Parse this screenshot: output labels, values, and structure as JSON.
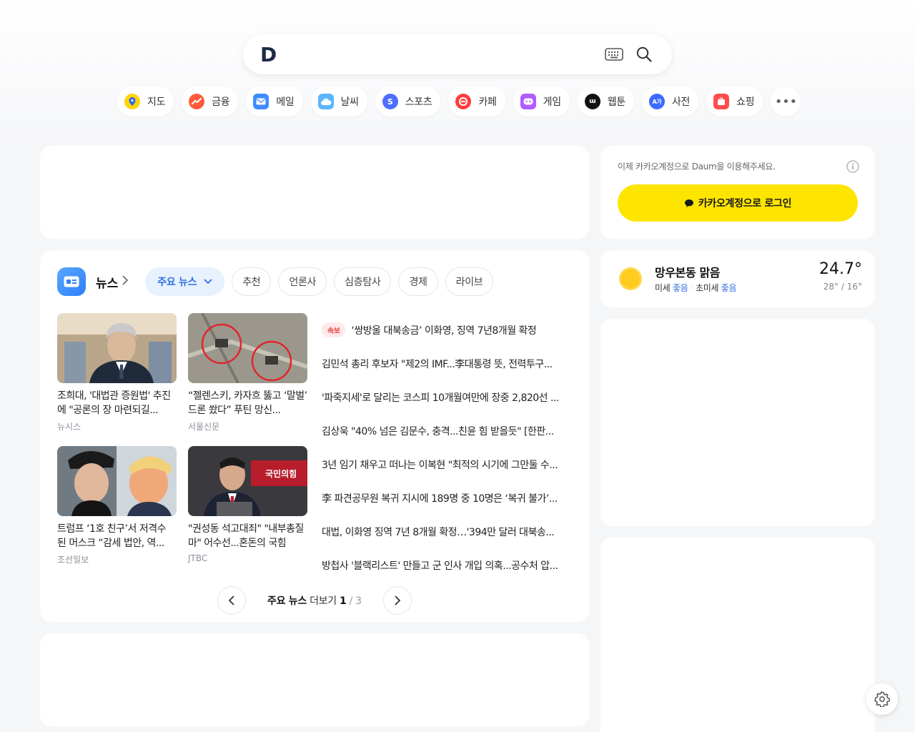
{
  "header": {
    "logo": "D",
    "search_placeholder": ""
  },
  "services": [
    {
      "label": "지도",
      "icon": "map-pin-icon",
      "color": "#ffd400"
    },
    {
      "label": "금융",
      "icon": "chart-up-icon",
      "color": "#ff5b3a"
    },
    {
      "label": "메일",
      "icon": "mail-icon",
      "color": "#3d8bff"
    },
    {
      "label": "날씨",
      "icon": "cloud-icon",
      "color": "#5bb6ff"
    },
    {
      "label": "스포츠",
      "icon": "sports-icon",
      "color": "#4c6fff"
    },
    {
      "label": "카페",
      "icon": "cafe-icon",
      "color": "#ff3b3b"
    },
    {
      "label": "게임",
      "icon": "game-icon",
      "color": "#b05cff"
    },
    {
      "label": "웹툰",
      "icon": "webtoon-icon",
      "color": "#111111"
    },
    {
      "label": "사전",
      "icon": "dictionary-icon",
      "color": "#3d6bff"
    },
    {
      "label": "쇼핑",
      "icon": "shopping-bag-icon",
      "color": "#ff4d4d"
    }
  ],
  "login": {
    "message": "이제 카카오계정으로 Daum을 이용해주세요.",
    "button": "카카오계정으로 로그인"
  },
  "weather": {
    "location_condition": "망우본동 맑음",
    "dust_label": "미세",
    "dust_value": "좋음",
    "fine_dust_label": "초미세",
    "fine_dust_value": "좋음",
    "temp": "24.7°",
    "range": "28° / 16°"
  },
  "news": {
    "title": "뉴스",
    "tabs": [
      {
        "label": "주요 뉴스",
        "active": true
      },
      {
        "label": "추천"
      },
      {
        "label": "언론사"
      },
      {
        "label": "심층탐사"
      },
      {
        "label": "경제"
      },
      {
        "label": "라이브"
      }
    ],
    "thumbs": [
      {
        "title": "조희대, '대법관 증원법' 추진에 \"공론의 장 마련되길...",
        "source": "뉴시스"
      },
      {
        "title": "“젤렌스키, 카자흐 뚫고 ‘말벌’ 드론 쐈다” 푸틴 망신...",
        "source": "서울신문"
      },
      {
        "title": "트럼프 ‘1호 친구’서 저격수 된 머스크 “감세 법안, 역...",
        "source": "조선일보"
      },
      {
        "title": "\"권성동 석고대죄\" \"내부총질 마\" 어수선...혼돈의 국힘",
        "source": "JTBC"
      }
    ],
    "breaking_badge": "속보",
    "headlines": [
      "‘쌍방울 대북송금’ 이화영, 징역 7년8개월 확정",
      "김민석 총리 후보자 \"제2의 IMF...李대통령 뜻, 전력투구...",
      "'파죽지세'로 달리는 코스피 10개월여만에 장중 2,820선 ...",
      "김상욱 \"40% 넘은 김문수, 충격...친윤 힘 받을듯\" [한판...",
      "3년 임기 채우고 떠나는 이복현 \"최적의 시기에 그만둘 수...",
      "李 파견공무원 복귀 지시에 189명 중 10명은 ‘복귀 불가’...",
      "대법, 이화영 징역 7년 8개월 확정…'394만 달러 대북송...",
      "방첩사 '블랙리스트' 만들고 군 인사 개입 의혹...공수처 압..."
    ],
    "pager": {
      "label": "주요 뉴스",
      "more": "더보기",
      "current": "1",
      "sep": "/",
      "total": "3"
    }
  }
}
